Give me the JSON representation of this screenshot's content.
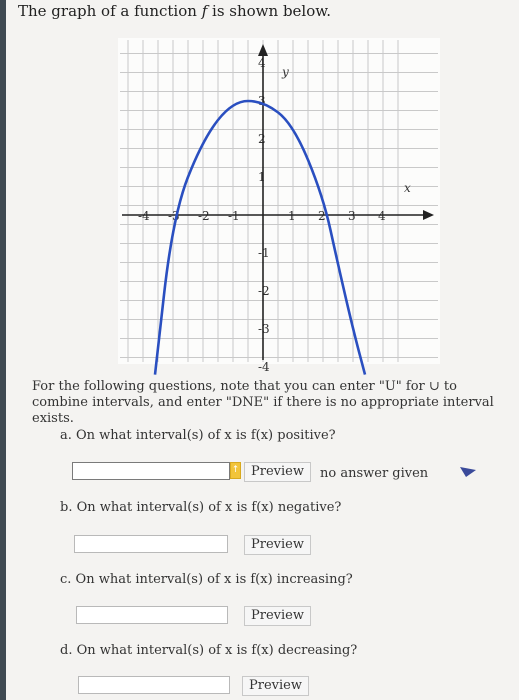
{
  "header": {
    "prefix": "The graph of a function ",
    "fvar": "f",
    "suffix": " is shown below."
  },
  "graph": {
    "x_label": "x",
    "y_label": "y",
    "x_ticks": [
      "-4",
      "-3",
      "-2",
      "-1",
      "1",
      "2",
      "3",
      "4"
    ],
    "y_ticks": [
      "4",
      "3",
      "2",
      "1",
      "-1",
      "-2",
      "-3",
      "-4"
    ],
    "curve_color": "#2a4fc0"
  },
  "chart_data": {
    "type": "line",
    "title": "",
    "xlabel": "x",
    "ylabel": "y",
    "xlim": [
      -4.5,
      4.5
    ],
    "ylim": [
      -4.5,
      4.5
    ],
    "grid": true,
    "series": [
      {
        "x": [
          -3.6,
          -3.0,
          -2.0,
          -1.0,
          0.0,
          1.0,
          2.0,
          2.5,
          3.0,
          3.4
        ],
        "y": [
          -4.2,
          0.0,
          2.0,
          3.0,
          3.0,
          2.4,
          0.5,
          -1.3,
          -3.0,
          -4.2
        ]
      }
    ],
    "annotations": [
      "vertex near (0.2, 3.2)",
      "x-intercepts near -3 and 2.5"
    ]
  },
  "instructions": "For the following questions, note that you can enter \"U\" for ∪ to combine intervals, and enter \"DNE\" if there is no appropriate interval exists.",
  "questions": [
    {
      "text": "a. On what interval(s) of x is f(x) positive?",
      "value": "",
      "preview": "Preview"
    },
    {
      "text": "b. On what interval(s) of x is f(x) negative?",
      "value": "",
      "preview": "Preview"
    },
    {
      "text": "c. On what interval(s) of x is f(x) increasing?",
      "value": "",
      "preview": "Preview"
    },
    {
      "text": "d. On what interval(s) of x is f(x) decreasing?",
      "value": "",
      "preview": "Preview"
    }
  ],
  "status": "no answer given",
  "icons": {
    "flag": "flag-icon",
    "warning": "warning-triangle-icon"
  }
}
